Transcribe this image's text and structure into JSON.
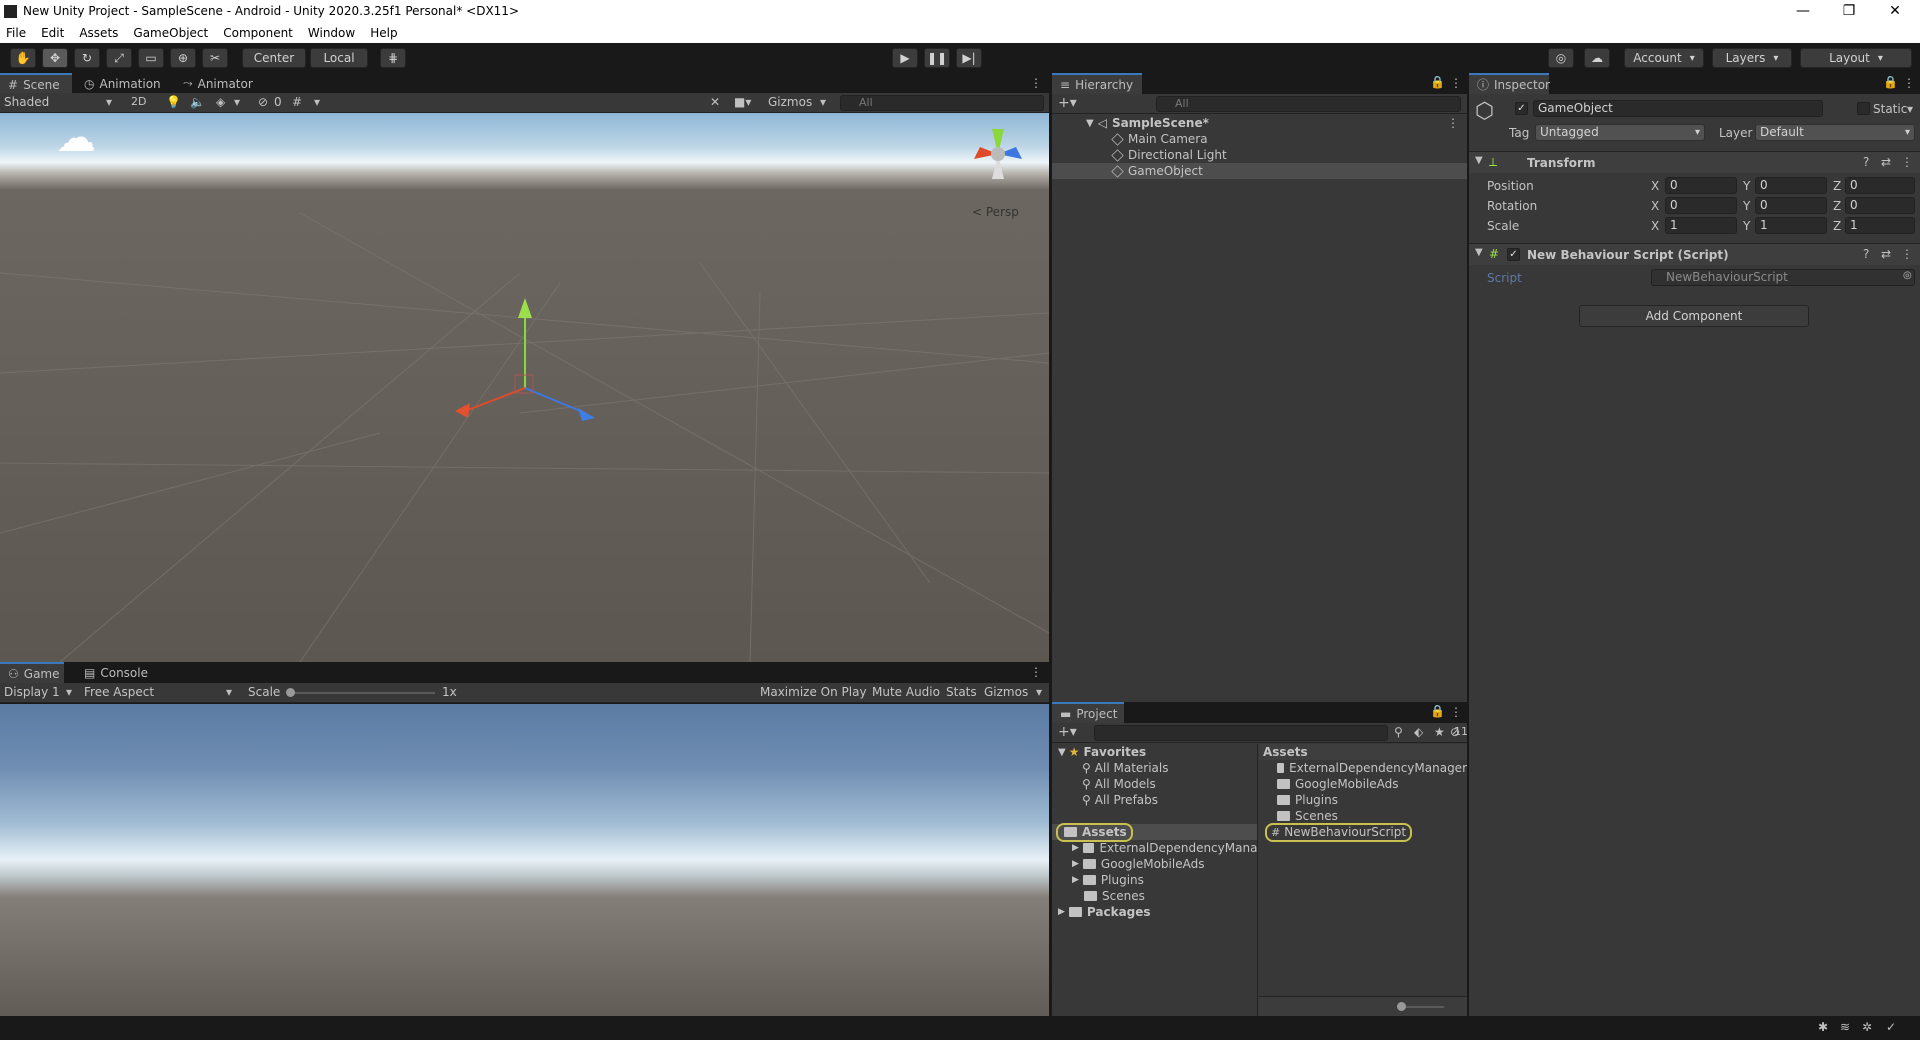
{
  "window": {
    "title": "New Unity Project - SampleScene - Android - Unity 2020.3.25f1 Personal* <DX11>",
    "minimize": "—",
    "restore": "❐",
    "close": "✕"
  },
  "menu": [
    "File",
    "Edit",
    "Assets",
    "GameObject",
    "Component",
    "Window",
    "Help"
  ],
  "toolbar": {
    "pivot": "Center",
    "space": "Local",
    "account": "Account",
    "layers": "Layers",
    "layout": "Layout"
  },
  "scene_tabs": [
    "Scene",
    "Animation",
    "Animator"
  ],
  "scene_bar": {
    "shading": "Shaded",
    "mode2d": "2D",
    "hidden_count": "0",
    "gizmos": "Gizmos",
    "search_placeholder": "All",
    "persp": "< Persp"
  },
  "game_tabs": [
    "Game",
    "Console"
  ],
  "game_bar": {
    "display": "Display 1",
    "aspect": "Free Aspect",
    "scale_label": "Scale",
    "scale_value": "1x",
    "maximize": "Maximize On Play",
    "mute": "Mute Audio",
    "stats": "Stats",
    "gizmos": "Gizmos"
  },
  "hierarchy": {
    "tab": "Hierarchy",
    "search_placeholder": "All",
    "scene": "SampleScene*",
    "items": [
      "Main Camera",
      "Directional Light",
      "GameObject"
    ]
  },
  "project": {
    "tab": "Project",
    "hidden_count": "11",
    "favorites": "Favorites",
    "fav_items": [
      "All Materials",
      "All Models",
      "All Prefabs"
    ],
    "assets_root": "Assets",
    "asset_folders": [
      "ExternalDependencyManager",
      "GoogleMobileAds",
      "Plugins",
      "Scenes"
    ],
    "packages": "Packages",
    "right_header": "Assets",
    "right_items": [
      "ExternalDependencyManager",
      "GoogleMobileAds",
      "Plugins",
      "Scenes"
    ],
    "script_item": "NewBehaviourScript"
  },
  "inspector": {
    "tab": "Inspector",
    "object_name": "GameObject",
    "static_label": "Static",
    "tag_label": "Tag",
    "tag_value": "Untagged",
    "layer_label": "Layer",
    "layer_value": "Default",
    "transform_title": "Transform",
    "position_label": "Position",
    "rotation_label": "Rotation",
    "scale_label": "Scale",
    "axes": [
      "X",
      "Y",
      "Z"
    ],
    "position": [
      "0",
      "0",
      "0"
    ],
    "rotation": [
      "0",
      "0",
      "0"
    ],
    "scale": [
      "1",
      "1",
      "1"
    ],
    "script_component": "New Behaviour Script (Script)",
    "script_label": "Script",
    "script_value": "NewBehaviourScript",
    "add_component": "Add Component"
  },
  "colors": {
    "accent": "#3a79bb",
    "highlight": "#c8c050",
    "panel": "#383838"
  }
}
